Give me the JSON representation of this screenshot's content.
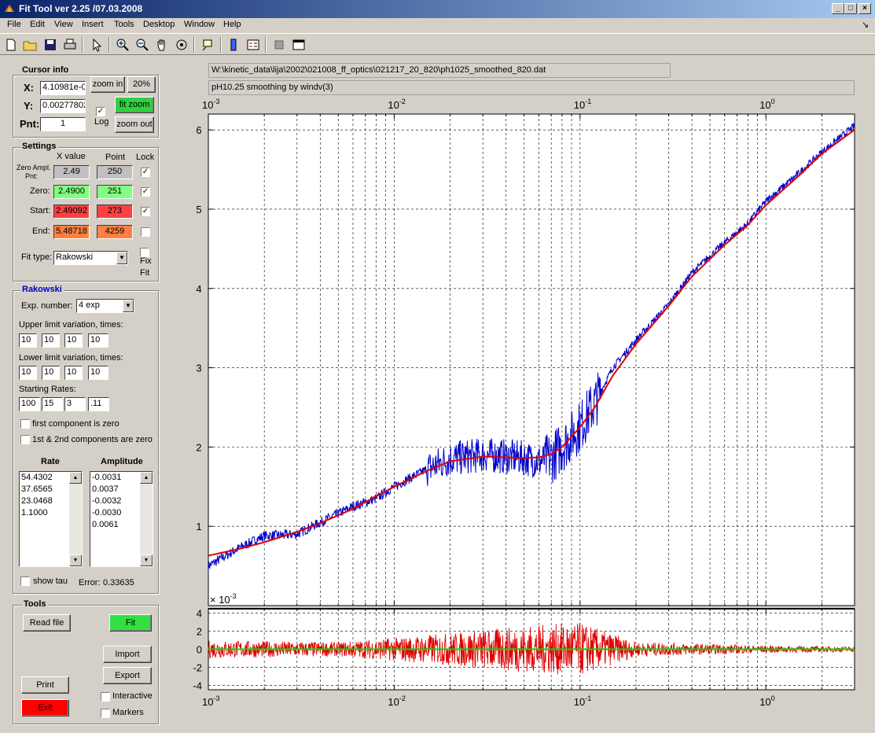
{
  "window": {
    "title": "Fit Tool ver 2.25 /07.03.2008",
    "min": "_",
    "max": "□",
    "close": "×"
  },
  "menu": [
    "File",
    "Edit",
    "View",
    "Insert",
    "Tools",
    "Desktop",
    "Window",
    "Help"
  ],
  "menu_corner": "↘",
  "cursor_info": {
    "title": "Cursor info",
    "x_label": "X:",
    "x_value": "4.10981e-0",
    "y_label": "Y:",
    "y_value": "0.00277802",
    "pnt_label": "Pnt:",
    "pnt_value": "1",
    "zoom_in": "zoom in",
    "pct": "20%",
    "fit_zoom": "fit zoom",
    "zoom_out": "zoom out",
    "log_label": "Log"
  },
  "settings": {
    "title": "Settings",
    "col_x": "X value",
    "col_point": "Point",
    "col_lock": "Lock",
    "rows": [
      {
        "label1": "Zero Ampl.",
        "label2": "Pnt:",
        "x": "2.49",
        "point": "250",
        "lock": "✓",
        "color": "#c0c0c0"
      },
      {
        "label1": "Zero:",
        "label2": "",
        "x": "2.4900",
        "point": "251",
        "lock": "✓",
        "color": "#80ff80"
      },
      {
        "label1": "Start:",
        "label2": "",
        "x": "2.49092",
        "point": "273",
        "lock": "✓",
        "color": "#ff4040"
      },
      {
        "label1": "End:",
        "label2": "",
        "x": "5.48718",
        "point": "4259",
        "lock": "",
        "color": "#ff8040"
      }
    ],
    "fit_type_label": "Fit type:",
    "fit_type": "Rakowski",
    "fix_fit_1": "Fix",
    "fix_fit_2": "Fit"
  },
  "rakowski": {
    "title": "Rakowski",
    "exp_label": "Exp. number:",
    "exp_value": "4 exp",
    "upper_label": "Upper limit variation, times:",
    "upper": [
      "10",
      "10",
      "10",
      "10"
    ],
    "lower_label": "Lower limit variation, times:",
    "lower": [
      "10",
      "10",
      "10",
      "10"
    ],
    "rates_label": "Starting Rates:",
    "rates": [
      "100",
      "15",
      "3",
      ".11"
    ],
    "first_zero": "first component is zero",
    "both_zero": "1st & 2nd components are zero",
    "rate_header": "Rate",
    "amp_header": "Amplitude",
    "rate_list": [
      "54.4302",
      "37.6565",
      "23.0468",
      "1.1000"
    ],
    "amp_list": [
      "-0.0031",
      "0.0037",
      "-0.0032",
      "-0.0030",
      "0.0061"
    ],
    "show_tau": "show tau",
    "error_label": "Error:",
    "error_value": "0.33635"
  },
  "tools": {
    "title": "Tools",
    "read_file": "Read file",
    "fit": "Fit",
    "import": "Import",
    "export": "Export",
    "print": "Print",
    "exit": "Exit",
    "interactive": "Interactive",
    "markers": "Markers"
  },
  "file_path": "W:\\kinetic_data\\lija\\2002\\021008_ff_optics\\021217_20_820\\ph1025_smoothed_820.dat",
  "description": "pH10.25 smoothing by windv(3)",
  "colors": {
    "data": "#0000c8",
    "fit": "#e00000",
    "residual": "#e00000",
    "zero_line": "#00e000",
    "titlebar": "#0a246a"
  },
  "chart_data": [
    {
      "type": "line",
      "xscale": "log",
      "xlim": [
        0.001,
        3.0
      ],
      "ylim": [
        0,
        6.2
      ],
      "x_ticklabels": [
        "10^-3",
        "10^-2",
        "10^-1",
        "10^0"
      ],
      "y_ticks": [
        1,
        2,
        3,
        4,
        5,
        6
      ],
      "grid": true,
      "series": [
        {
          "kind": "data",
          "x": [
            0.001,
            0.0015,
            0.002,
            0.003,
            0.004,
            0.006,
            0.008,
            0.01,
            0.015,
            0.02,
            0.03,
            0.04,
            0.05,
            0.06,
            0.07,
            0.08,
            0.1,
            0.12,
            0.15,
            0.2,
            0.3,
            0.4,
            0.6,
            0.8,
            1.0,
            1.5,
            2.0,
            3.0
          ],
          "y": [
            0.5,
            0.74,
            0.88,
            0.9,
            1.05,
            1.25,
            1.35,
            1.5,
            1.72,
            1.85,
            1.9,
            1.88,
            1.86,
            1.82,
            1.86,
            2.0,
            2.26,
            2.55,
            3.0,
            3.35,
            3.8,
            4.2,
            4.58,
            4.82,
            5.1,
            5.45,
            5.72,
            6.05
          ]
        },
        {
          "kind": "fit",
          "x": [
            0.001,
            0.0015,
            0.002,
            0.003,
            0.004,
            0.006,
            0.008,
            0.01,
            0.015,
            0.02,
            0.03,
            0.04,
            0.05,
            0.06,
            0.07,
            0.08,
            0.1,
            0.12,
            0.15,
            0.2,
            0.3,
            0.4,
            0.6,
            0.8,
            1.0,
            1.5,
            2.0,
            3.0
          ],
          "y": [
            0.63,
            0.72,
            0.8,
            0.93,
            1.04,
            1.22,
            1.38,
            1.5,
            1.7,
            1.82,
            1.88,
            1.87,
            1.86,
            1.87,
            1.91,
            2.0,
            2.25,
            2.5,
            2.9,
            3.3,
            3.78,
            4.15,
            4.55,
            4.8,
            5.05,
            5.42,
            5.7,
            6.0
          ]
        }
      ]
    },
    {
      "type": "line",
      "xscale": "log",
      "xlim": [
        0.001,
        3.0
      ],
      "ylim": [
        -4.5,
        4.5
      ],
      "y_ticks": [
        4,
        2,
        0,
        -2,
        -4
      ],
      "x_ticklabels": [
        "10^-3",
        "10^-2",
        "10^-1",
        "10^0"
      ],
      "exponent_label": "× 10^-3",
      "grid": true,
      "series": [
        {
          "kind": "residual",
          "noise_by_decade": [
            {
              "x": 0.001,
              "amp": 1.0
            },
            {
              "x": 0.005,
              "amp": 0.8
            },
            {
              "x": 0.015,
              "amp": 1.6
            },
            {
              "x": 0.04,
              "amp": 2.4
            },
            {
              "x": 0.1,
              "amp": 3.0
            },
            {
              "x": 0.2,
              "amp": 0.8
            },
            {
              "x": 1.0,
              "amp": 0.4
            },
            {
              "x": 3.0,
              "amp": 0.3
            }
          ]
        },
        {
          "kind": "zero",
          "y": 0
        }
      ]
    }
  ]
}
